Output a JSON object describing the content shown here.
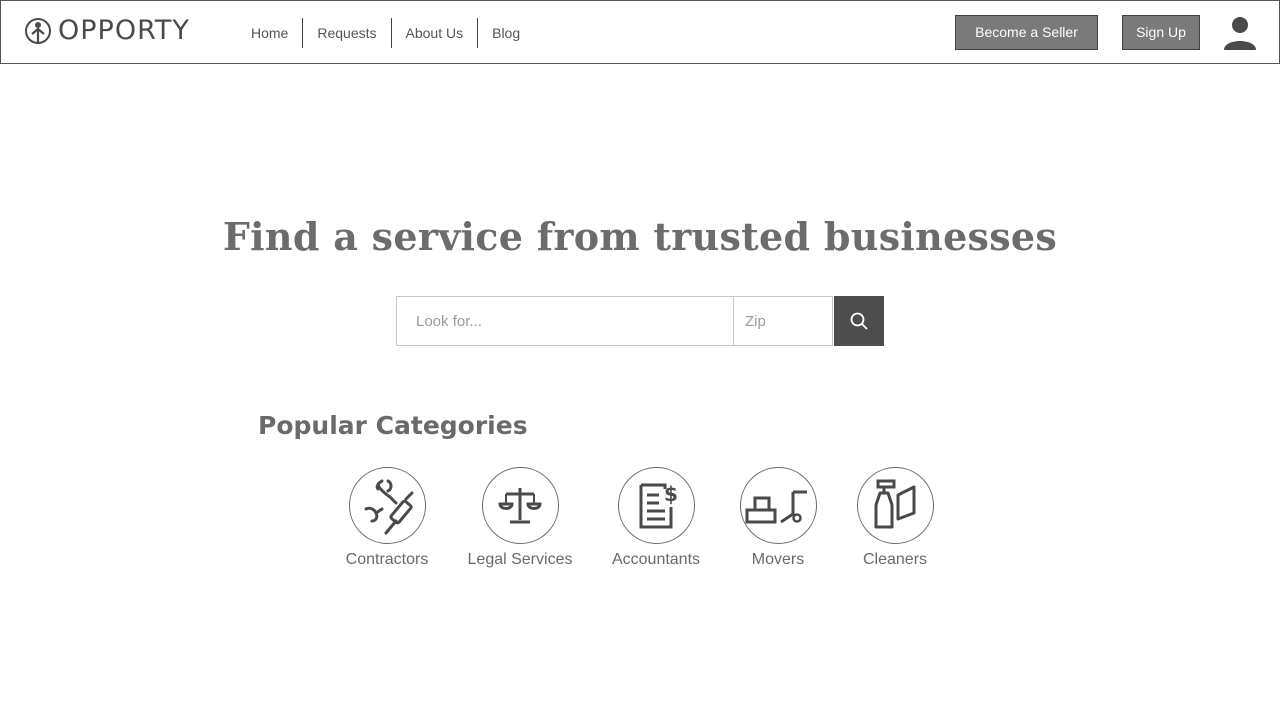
{
  "brand": {
    "name": "OPPORTY"
  },
  "nav": {
    "items": [
      "Home",
      "Requests",
      "About Us",
      "Blog"
    ]
  },
  "header": {
    "become_seller": "Become a Seller",
    "sign_up": "Sign Up"
  },
  "hero": {
    "title": "Find a service from trusted businesses"
  },
  "search": {
    "placeholder": "Look for...",
    "zip_placeholder": "Zip"
  },
  "categories": {
    "heading": "Popular Categories",
    "items": [
      {
        "label": "Contractors",
        "icon": "tools-icon"
      },
      {
        "label": "Legal Services",
        "icon": "scales-icon"
      },
      {
        "label": "Accountants",
        "icon": "document-dollar-icon"
      },
      {
        "label": "Movers",
        "icon": "hand-truck-icon"
      },
      {
        "label": "Cleaners",
        "icon": "spray-bottle-icon"
      }
    ]
  },
  "colors": {
    "button_bg": "#7a7a7a",
    "search_button_bg": "#4d4d4d",
    "text": "#6a6a6a"
  }
}
